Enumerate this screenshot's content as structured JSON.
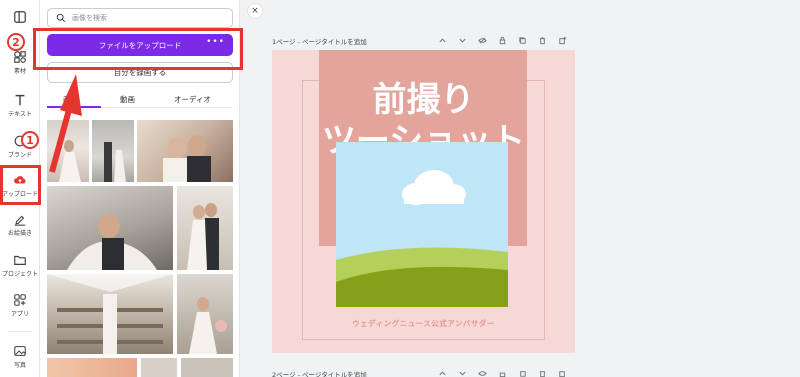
{
  "rail": {
    "items": [
      {
        "label": ""
      },
      {
        "label": "素材"
      },
      {
        "label": "テキスト"
      },
      {
        "label": "ブランド"
      },
      {
        "label": "アップロード"
      },
      {
        "label": "お絵描き"
      },
      {
        "label": "プロジェクト"
      },
      {
        "label": "アプリ"
      },
      {
        "label": "写真"
      }
    ]
  },
  "panel": {
    "search_placeholder": "画像を検索",
    "upload_button": "ファイルをアップロード",
    "upload_more": "•••",
    "record_button": "自分を録画する",
    "tabs": [
      "画像",
      "動画",
      "オーディオ"
    ],
    "active_tab": 0
  },
  "canvas": {
    "close": "×",
    "page1_title": "1ページ - ページタイトルを追加",
    "page2_title": "2ページ - ページタイトルを追加",
    "design": {
      "title_line1": "前撮り",
      "title_line2": "ツーショット",
      "footer": "ウェディングニュース公式アンバサダー"
    }
  },
  "annotations": {
    "badge1": "1",
    "badge2": "2",
    "color": "#e5352f"
  },
  "colors": {
    "accent": "#7d2ae8",
    "design_bg": "#f6d8d6",
    "banner": "#e3a49c",
    "sky": "#bfe6f7",
    "grass": "#8aa11e"
  }
}
